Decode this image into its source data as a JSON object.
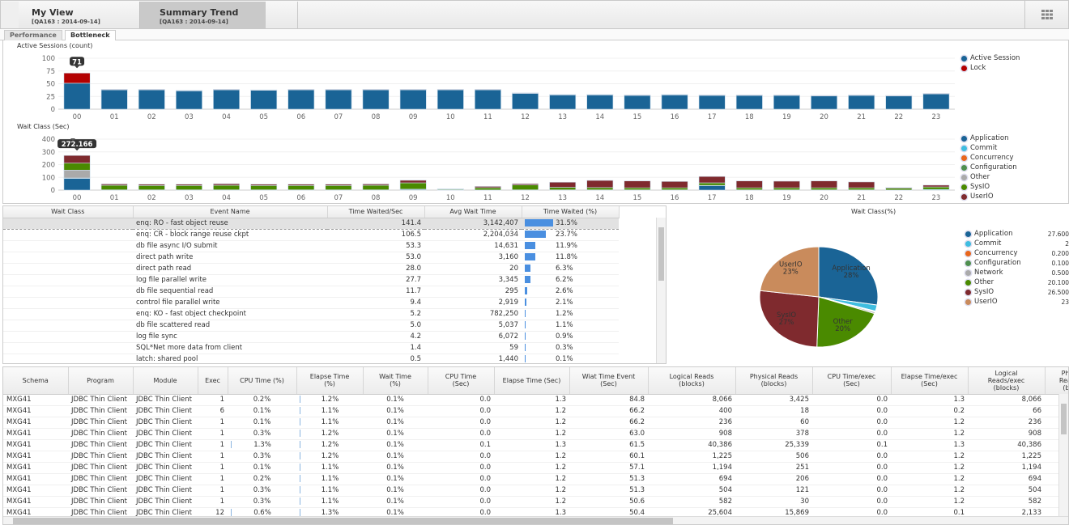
{
  "top_tabs": [
    {
      "title": "My View",
      "subtitle": "[QA163 : 2014-09-14]"
    },
    {
      "title": "Summary Trend",
      "subtitle": "[QA163 : 2014-09-14]"
    }
  ],
  "sub_tabs": [
    "Performance",
    "Bottleneck"
  ],
  "grid_icon": "grid-icon",
  "chart_data": [
    {
      "type": "bar",
      "title": "Active Sessions (count)",
      "categories": [
        "00",
        "01",
        "02",
        "03",
        "04",
        "05",
        "06",
        "07",
        "08",
        "09",
        "10",
        "11",
        "12",
        "13",
        "14",
        "15",
        "16",
        "17",
        "18",
        "19",
        "20",
        "21",
        "22",
        "23"
      ],
      "ylim": [
        0,
        100
      ],
      "yticks": [
        "0",
        "25",
        "50",
        "75",
        "100"
      ],
      "series": [
        {
          "name": "Active Session",
          "color": "#1a6496",
          "values": [
            51,
            38,
            38,
            36,
            38,
            37,
            38,
            38,
            38,
            38,
            38,
            38,
            31,
            28,
            28,
            27,
            28,
            27,
            27,
            27,
            26,
            27,
            26,
            30
          ]
        },
        {
          "name": "Lock",
          "color": "#b30000",
          "values": [
            20,
            1,
            1,
            1,
            1,
            1,
            1,
            1,
            1,
            1,
            1,
            1,
            1,
            1,
            1,
            1,
            1,
            1,
            1,
            1,
            1,
            1,
            1,
            1
          ]
        }
      ],
      "tooltip": {
        "category": "00",
        "text": "71"
      }
    },
    {
      "type": "bar",
      "title": "Wait Class (Sec)",
      "categories": [
        "00",
        "01",
        "02",
        "03",
        "04",
        "05",
        "06",
        "07",
        "08",
        "09",
        "10",
        "11",
        "12",
        "13",
        "14",
        "15",
        "16",
        "17",
        "18",
        "19",
        "20",
        "21",
        "22",
        "23"
      ],
      "ylim": [
        0,
        400
      ],
      "yticks": [
        "0",
        "100",
        "200",
        "300",
        "400"
      ],
      "series": [
        {
          "name": "Application",
          "color": "#1a6496",
          "values": [
            92,
            0,
            0,
            0,
            0,
            0,
            0,
            0,
            0,
            5,
            0,
            0,
            0,
            0,
            0,
            0,
            0,
            35,
            0,
            0,
            0,
            0,
            0,
            0
          ]
        },
        {
          "name": "Commit",
          "color": "#3fbde0",
          "values": [
            3,
            2,
            2,
            2,
            2,
            2,
            2,
            2,
            2,
            2,
            1,
            1,
            2,
            2,
            2,
            2,
            2,
            2,
            2,
            2,
            2,
            2,
            1,
            5
          ]
        },
        {
          "name": "Concurrency",
          "color": "#e8661c",
          "values": [
            0,
            0,
            0,
            0,
            0,
            0,
            0,
            0,
            0,
            0,
            0,
            0,
            0,
            0,
            0,
            0,
            0,
            0,
            0,
            0,
            0,
            0,
            0,
            0
          ]
        },
        {
          "name": "Configuration",
          "color": "#4f8f4f",
          "values": [
            0,
            0,
            0,
            0,
            0,
            0,
            0,
            0,
            0,
            0,
            0,
            0,
            0,
            0,
            0,
            0,
            0,
            0,
            0,
            0,
            0,
            0,
            0,
            0
          ]
        },
        {
          "name": "Other",
          "color": "#aaaaaa",
          "values": [
            62,
            0,
            0,
            0,
            0,
            0,
            0,
            0,
            0,
            0,
            0,
            0,
            0,
            0,
            0,
            0,
            0,
            0,
            0,
            0,
            0,
            0,
            0,
            0
          ]
        },
        {
          "name": "SysIO",
          "color": "#4a8a00",
          "values": [
            55,
            36,
            34,
            34,
            36,
            34,
            34,
            34,
            36,
            50,
            6,
            18,
            38,
            20,
            18,
            16,
            16,
            20,
            16,
            16,
            16,
            16,
            14,
            20
          ]
        },
        {
          "name": "UserIO",
          "color": "#7f2a2e",
          "values": [
            60,
            10,
            10,
            10,
            12,
            10,
            10,
            10,
            10,
            20,
            3,
            10,
            10,
            40,
            56,
            54,
            50,
            50,
            54,
            52,
            54,
            46,
            5,
            14
          ]
        }
      ],
      "tooltip": {
        "category": "00",
        "text": "272.166"
      }
    },
    {
      "type": "pie",
      "title": "Wait Class(%)",
      "slices": [
        {
          "name": "Application",
          "value": 27.6,
          "display": "27.600",
          "label": "Application\n28%",
          "color": "#1a6496"
        },
        {
          "name": "Commit",
          "value": 2,
          "display": "2",
          "label": "",
          "color": "#3fbde0"
        },
        {
          "name": "Concurrency",
          "value": 0.2,
          "display": "0.200",
          "label": "",
          "color": "#e8661c"
        },
        {
          "name": "Configuration",
          "value": 0.1,
          "display": "0.100",
          "label": "",
          "color": "#4f8f4f"
        },
        {
          "name": "Network",
          "value": 0.5,
          "display": "0.500",
          "label": "",
          "color": "#aaaaaa"
        },
        {
          "name": "Other",
          "value": 20.1,
          "display": "20.100",
          "label": "Other\n20%",
          "color": "#4a8a00"
        },
        {
          "name": "SysIO",
          "value": 26.5,
          "display": "26.500",
          "label": "SysIO\n27%",
          "color": "#7f2a2e"
        },
        {
          "name": "UserIO",
          "value": 23,
          "display": "23",
          "label": "UserIO\n23%",
          "color": "#c98b5c"
        }
      ]
    }
  ],
  "events_table": {
    "columns": [
      "Wait Class",
      "Event Name",
      "Time Waited/Sec",
      "Avg Wait Time",
      "Time Waited (%)"
    ],
    "rows": [
      {
        "wait_class": "",
        "event": "enq: RO - fast object reuse",
        "tws": "141.4",
        "avg": "3,142,407",
        "pct": 31.5,
        "pct_text": "31.5%"
      },
      {
        "wait_class": "",
        "event": "enq: CR - block range reuse ckpt",
        "tws": "106.5",
        "avg": "2,204,034",
        "pct": 23.7,
        "pct_text": "23.7%"
      },
      {
        "wait_class": "",
        "event": "db file async I/O submit",
        "tws": "53.3",
        "avg": "14,631",
        "pct": 11.9,
        "pct_text": "11.9%"
      },
      {
        "wait_class": "",
        "event": "direct path write",
        "tws": "53.0",
        "avg": "3,160",
        "pct": 11.8,
        "pct_text": "11.8%"
      },
      {
        "wait_class": "",
        "event": "direct path read",
        "tws": "28.0",
        "avg": "20",
        "pct": 6.3,
        "pct_text": "6.3%"
      },
      {
        "wait_class": "",
        "event": "log file parallel write",
        "tws": "27.7",
        "avg": "3,345",
        "pct": 6.2,
        "pct_text": "6.2%"
      },
      {
        "wait_class": "",
        "event": "db file sequential read",
        "tws": "11.7",
        "avg": "295",
        "pct": 2.6,
        "pct_text": "2.6%"
      },
      {
        "wait_class": "",
        "event": "control file parallel write",
        "tws": "9.4",
        "avg": "2,919",
        "pct": 2.1,
        "pct_text": "2.1%"
      },
      {
        "wait_class": "",
        "event": "enq: KO - fast object checkpoint",
        "tws": "5.2",
        "avg": "782,250",
        "pct": 1.2,
        "pct_text": "1.2%"
      },
      {
        "wait_class": "",
        "event": "db file scattered read",
        "tws": "5.0",
        "avg": "5,037",
        "pct": 1.1,
        "pct_text": "1.1%"
      },
      {
        "wait_class": "",
        "event": "log file sync",
        "tws": "4.2",
        "avg": "6,072",
        "pct": 0.9,
        "pct_text": "0.9%"
      },
      {
        "wait_class": "",
        "event": "SQL*Net more data from client",
        "tws": "1.4",
        "avg": "59",
        "pct": 0.3,
        "pct_text": "0.3%"
      },
      {
        "wait_class": "",
        "event": "latch: shared pool",
        "tws": "0.5",
        "avg": "1,440",
        "pct": 0.1,
        "pct_text": "0.1%"
      }
    ]
  },
  "sql_table": {
    "columns": [
      "Schema",
      "Program",
      "Module",
      "Exec",
      "CPU Time (%)",
      "Elapse Time (%)",
      "Wait Time (%)",
      "CPU Time (Sec)",
      "Elapse Time (Sec)",
      "Wiat Time Event (Sec)",
      "Logical Reads (blocks)",
      "Physical Reads (blocks)",
      "CPU Time/exec (Sec)",
      "Elapse Time/exec (Sec)",
      "Logical Reads/exec (blocks)",
      "Phys Reads (blo"
    ],
    "rows": [
      [
        "MXG41",
        "JDBC Thin Client",
        "JDBC Thin Client",
        "1",
        "0.2%",
        "1.2%",
        "0.1%",
        "0.0",
        "1.3",
        "84.8",
        "8,066",
        "3,425",
        "0.0",
        "1.3",
        "8,066",
        ""
      ],
      [
        "MXG41",
        "JDBC Thin Client",
        "JDBC Thin Client",
        "6",
        "0.1%",
        "1.1%",
        "0.1%",
        "0.0",
        "1.2",
        "66.2",
        "400",
        "18",
        "0.0",
        "0.2",
        "66",
        ""
      ],
      [
        "MXG41",
        "JDBC Thin Client",
        "JDBC Thin Client",
        "1",
        "0.1%",
        "1.1%",
        "0.1%",
        "0.0",
        "1.2",
        "66.2",
        "236",
        "60",
        "0.0",
        "1.2",
        "236",
        ""
      ],
      [
        "MXG41",
        "JDBC Thin Client",
        "JDBC Thin Client",
        "1",
        "0.3%",
        "1.2%",
        "0.1%",
        "0.0",
        "1.2",
        "63.0",
        "908",
        "378",
        "0.0",
        "1.2",
        "908",
        ""
      ],
      [
        "MXG41",
        "JDBC Thin Client",
        "JDBC Thin Client",
        "1",
        "1.3%",
        "1.2%",
        "0.1%",
        "0.1",
        "1.3",
        "61.5",
        "40,386",
        "25,339",
        "0.1",
        "1.3",
        "40,386",
        ""
      ],
      [
        "MXG41",
        "JDBC Thin Client",
        "JDBC Thin Client",
        "1",
        "0.3%",
        "1.2%",
        "0.1%",
        "0.0",
        "1.2",
        "60.1",
        "1,225",
        "506",
        "0.0",
        "1.2",
        "1,225",
        ""
      ],
      [
        "MXG41",
        "JDBC Thin Client",
        "JDBC Thin Client",
        "1",
        "0.1%",
        "1.1%",
        "0.1%",
        "0.0",
        "1.2",
        "57.1",
        "1,194",
        "251",
        "0.0",
        "1.2",
        "1,194",
        ""
      ],
      [
        "MXG41",
        "JDBC Thin Client",
        "JDBC Thin Client",
        "1",
        "0.2%",
        "1.1%",
        "0.1%",
        "0.0",
        "1.2",
        "51.3",
        "694",
        "206",
        "0.0",
        "1.2",
        "694",
        ""
      ],
      [
        "MXG41",
        "JDBC Thin Client",
        "JDBC Thin Client",
        "1",
        "0.3%",
        "1.1%",
        "0.1%",
        "0.0",
        "1.2",
        "51.3",
        "504",
        "121",
        "0.0",
        "1.2",
        "504",
        ""
      ],
      [
        "MXG41",
        "JDBC Thin Client",
        "JDBC Thin Client",
        "1",
        "0.3%",
        "1.1%",
        "0.1%",
        "0.0",
        "1.2",
        "50.6",
        "582",
        "30",
        "0.0",
        "1.2",
        "582",
        ""
      ],
      [
        "MXG41",
        "JDBC Thin Client",
        "JDBC Thin Client",
        "12",
        "0.6%",
        "1.3%",
        "0.1%",
        "0.0",
        "1.3",
        "50.4",
        "25,604",
        "15,869",
        "0.0",
        "0.1",
        "2,133",
        ""
      ]
    ]
  }
}
